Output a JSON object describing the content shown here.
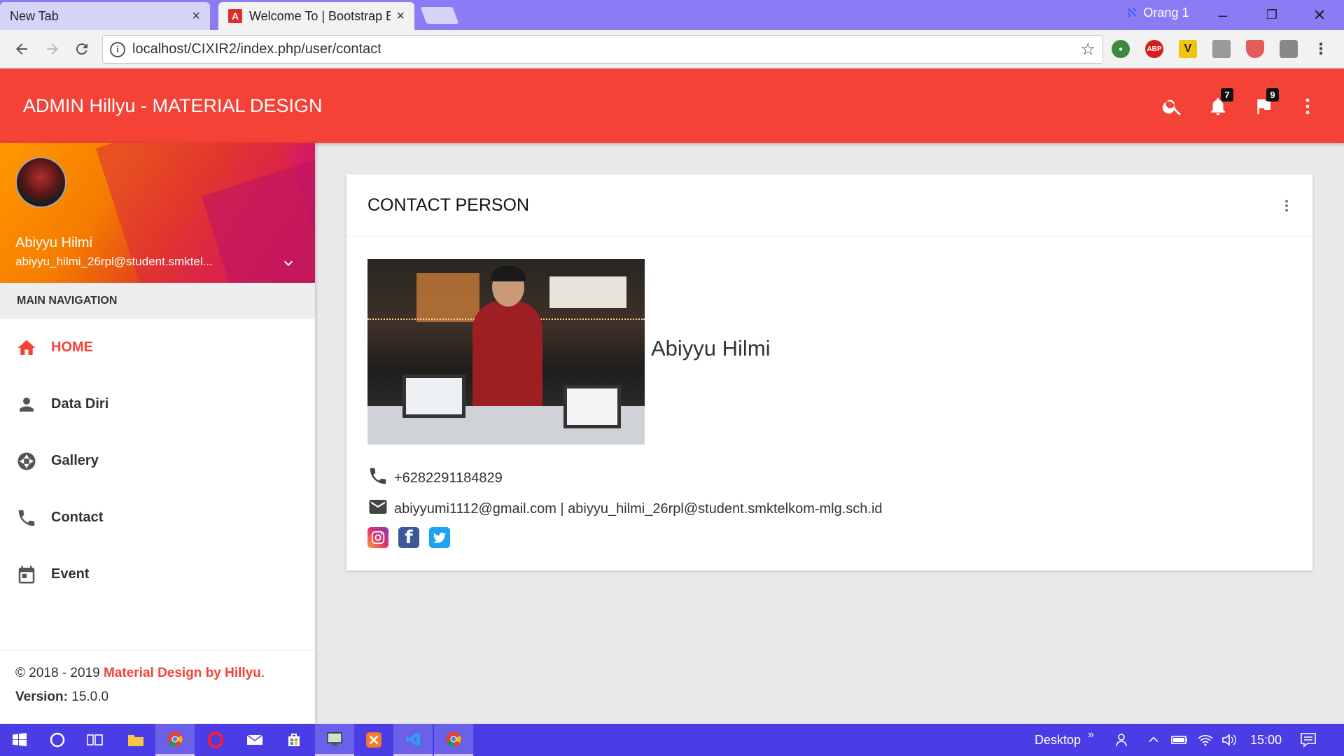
{
  "browser": {
    "tabs": [
      {
        "title": "New Tab",
        "close": "×"
      },
      {
        "title": "Welcome To | Bootstrap B",
        "close": "×",
        "favicon": "A"
      }
    ],
    "profile": "Orang 1",
    "window_controls": {
      "minimize": "–",
      "restore": "❐",
      "close": "✕"
    },
    "url": "localhost/CIXIR2/index.php/user/contact",
    "extensions": {
      "abp": "ABP",
      "v": "V"
    }
  },
  "app": {
    "title": "ADMIN Hillyu - MATERIAL DESIGN",
    "notifications_count": "7",
    "flags_count": "9",
    "accent_color": "#f44236"
  },
  "user": {
    "name": "Abiyyu Hilmi",
    "email": "abiyyu_hilmi_26rpl@student.smktel..."
  },
  "sidebar": {
    "nav_header": "MAIN NAVIGATION",
    "items": [
      {
        "label": "HOME",
        "icon": "home-icon",
        "active": true
      },
      {
        "label": "Data Diri",
        "icon": "person-icon",
        "active": false
      },
      {
        "label": "Gallery",
        "icon": "camera-shutter-icon",
        "active": false
      },
      {
        "label": "Contact",
        "icon": "phone-icon",
        "active": false
      },
      {
        "label": "Event",
        "icon": "calendar-icon",
        "active": false
      }
    ],
    "footer": {
      "copyright": "© 2018 - 2019 ",
      "brand": "Material Design by Hillyu",
      "period": ".",
      "version_label": "Version:",
      "version_value": " 15.0.0"
    }
  },
  "card": {
    "title": "CONTACT PERSON",
    "name": "Abiyyu Hilmi",
    "phone": "+6282291184829",
    "email": "abiyyumi1112@gmail.com | abiyyu_hilmi_26rpl@student.smktelkom-mlg.sch.id",
    "socials": [
      "instagram-icon",
      "facebook-icon",
      "twitter-icon"
    ]
  },
  "taskbar": {
    "desktop_label": "Desktop",
    "chevron": "»",
    "time": "15:00"
  }
}
